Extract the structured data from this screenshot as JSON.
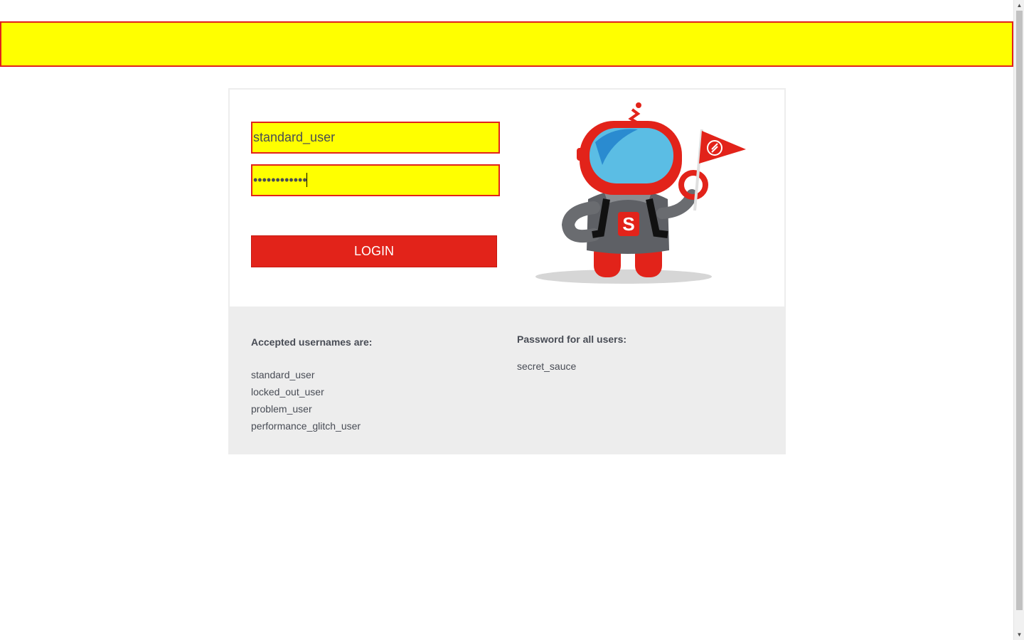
{
  "login_form": {
    "username_value": "standard_user",
    "password_value": "••••••••••••",
    "login_label": "LOGIN"
  },
  "mascot": {
    "icon": "robot-mascot-with-flag-icon"
  },
  "credentials": {
    "usernames_heading": "Accepted usernames are:",
    "usernames": [
      "standard_user",
      "locked_out_user",
      "problem_user",
      "performance_glitch_user"
    ],
    "password_heading": "Password for all users:",
    "password": "secret_sauce"
  },
  "scrollbar": {
    "up_icon": "▲",
    "down_icon": "▼"
  },
  "colors": {
    "accent": "#e2231a",
    "highlight": "#ffff00",
    "panel_bg": "#ededed",
    "text": "#484c55"
  }
}
